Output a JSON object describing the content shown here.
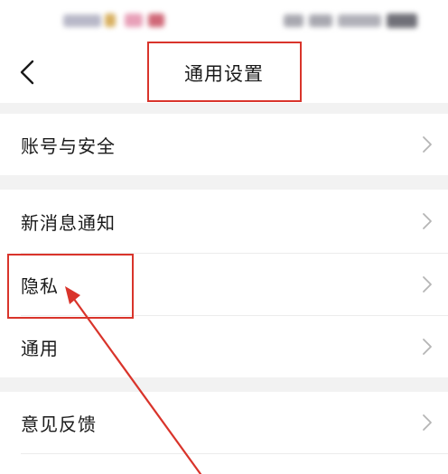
{
  "header": {
    "title": "通用设置",
    "back_icon": "chevron-left-icon"
  },
  "groups": [
    {
      "items": [
        {
          "label": "账号与安全"
        }
      ]
    },
    {
      "items": [
        {
          "label": "新消息通知"
        },
        {
          "label": "隐私"
        },
        {
          "label": "通用"
        }
      ]
    },
    {
      "items": [
        {
          "label": "意见反馈"
        }
      ]
    }
  ],
  "colors": {
    "annotation": "#d9342b",
    "separator_band": "#f2f2f2",
    "text": "#1a1a1a",
    "chevron": "#b5b5b5"
  }
}
